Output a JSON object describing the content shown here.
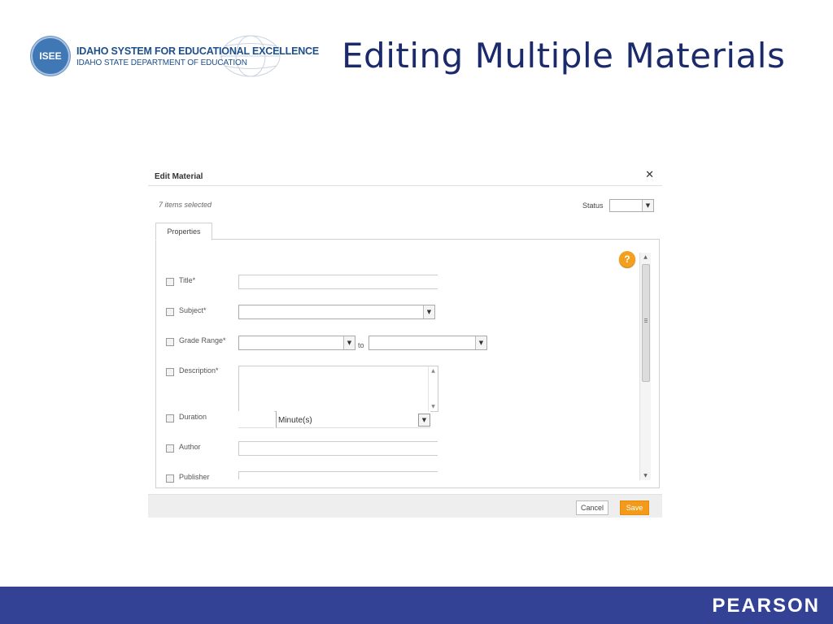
{
  "header": {
    "logo_seal_text": "ISEE",
    "logo_line1": "IDAHO SYSTEM FOR EDUCATIONAL EXCELLENCE",
    "logo_line2": "IDAHO STATE DEPARTMENT OF EDUCATION",
    "slide_title": "Editing Multiple Materials"
  },
  "dialog": {
    "title": "Edit Material",
    "close_icon": "close-icon",
    "selected_count": "7 items selected",
    "status_label": "Status",
    "status_value": "",
    "tab_label": "Properties",
    "help_icon_text": "?",
    "fields": {
      "title": {
        "label": "Title*",
        "value": ""
      },
      "subject": {
        "label": "Subject*",
        "value": ""
      },
      "grade_range": {
        "label": "Grade Range*",
        "from_value": "",
        "to_label": "to",
        "to_value": ""
      },
      "description": {
        "label": "Description*",
        "value": ""
      },
      "duration": {
        "label": "Duration",
        "value": "",
        "unit": "Minute(s)"
      },
      "author": {
        "label": "Author",
        "value": ""
      },
      "publisher": {
        "label": "Publisher",
        "value": ""
      }
    },
    "cancel_label": "Cancel",
    "save_label": "Save"
  },
  "footer": {
    "brand": "PEARSON"
  },
  "colors": {
    "title_blue": "#1b2a6b",
    "bottom_bar": "#344295",
    "save_orange": "#f39a1b",
    "help_orange": "#f2a01e"
  }
}
